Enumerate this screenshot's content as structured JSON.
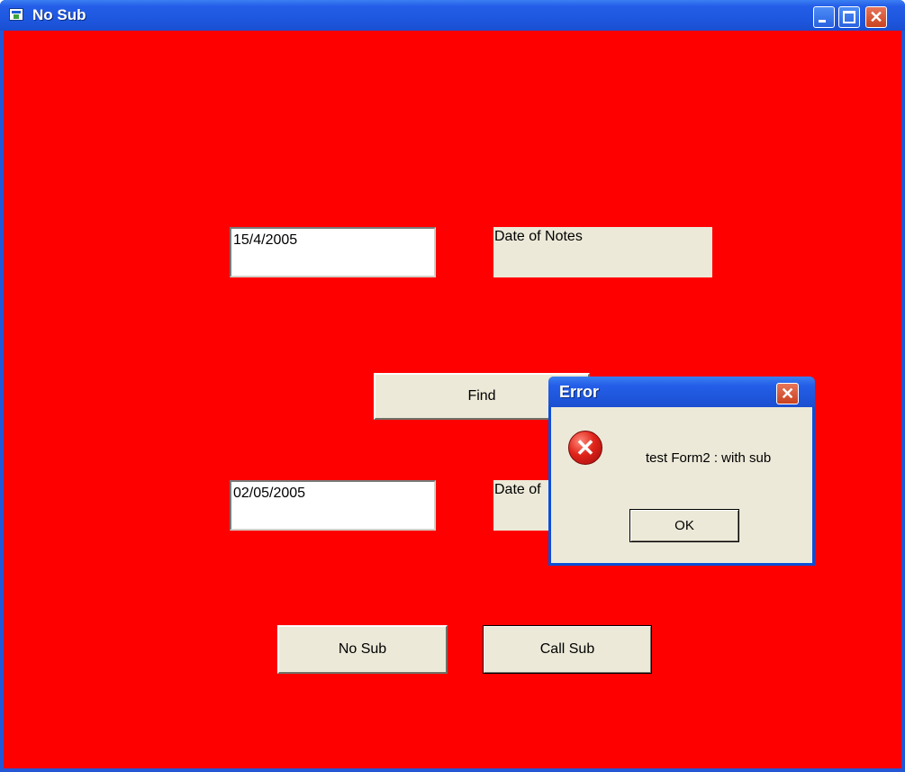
{
  "window": {
    "title": "No Sub",
    "client_color": "#FF0000"
  },
  "form": {
    "textbox1_value": "15/4/2005",
    "label1_text": "Date of Notes",
    "find_button": "Find",
    "textbox2_value": "02/05/2005",
    "label2_text": "Date of",
    "no_sub_button": "No Sub",
    "call_sub_button": "Call Sub"
  },
  "dialog": {
    "title": "Error",
    "message": "test Form2 : with sub",
    "ok_button": "OK",
    "icon": "error-icon"
  },
  "icons": {
    "minimize": "minimize-icon",
    "maximize": "maximize-icon",
    "close": "close-icon",
    "app": "app-window-icon"
  }
}
